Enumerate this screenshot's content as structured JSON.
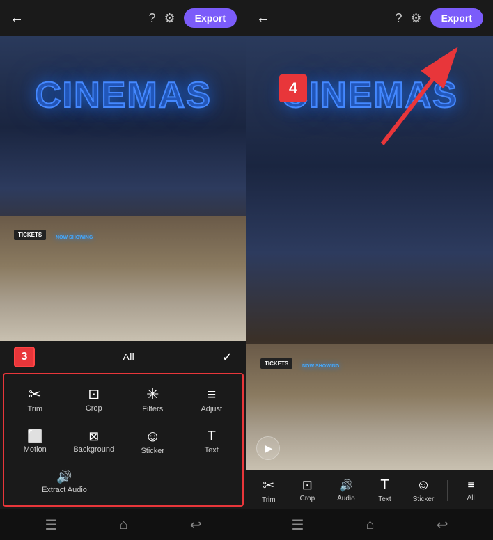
{
  "left": {
    "header": {
      "back_label": "←",
      "help_icon": "?",
      "settings_icon": "⚙",
      "export_label": "Export"
    },
    "cinema_text": "CINEMAS",
    "toolbar": {
      "all_label": "All",
      "step_number": "3",
      "tools": [
        {
          "id": "trim",
          "icon": "✂",
          "label": "Trim"
        },
        {
          "id": "crop",
          "icon": "⊡",
          "label": "Crop"
        },
        {
          "id": "filters",
          "icon": "✳",
          "label": "Filters"
        },
        {
          "id": "adjust",
          "icon": "≡",
          "label": "Adjust"
        },
        {
          "id": "motion",
          "icon": "⬜",
          "label": "Motion"
        },
        {
          "id": "background",
          "icon": "⊠",
          "label": "Background"
        },
        {
          "id": "sticker",
          "icon": "☺",
          "label": "Sticker"
        },
        {
          "id": "text",
          "icon": "T",
          "label": "Text"
        },
        {
          "id": "extract-audio",
          "icon": "🔊",
          "label": "Extract Audio"
        }
      ]
    },
    "bottom_nav": [
      "☰",
      "⌂",
      "↩"
    ]
  },
  "right": {
    "header": {
      "back_label": "←",
      "help_icon": "?",
      "settings_icon": "⚙",
      "export_label": "Export"
    },
    "cinema_text": "CINEMAS",
    "step_number": "4",
    "toolbar": {
      "tools": [
        {
          "id": "trim",
          "icon": "✂",
          "label": "Trim"
        },
        {
          "id": "crop",
          "icon": "⊡",
          "label": "Crop"
        },
        {
          "id": "audio",
          "icon": "🔊",
          "label": "Audio"
        },
        {
          "id": "text",
          "icon": "T",
          "label": "Text"
        },
        {
          "id": "sticker",
          "icon": "☺",
          "label": "Sticker"
        },
        {
          "id": "all",
          "icon": "≡",
          "label": "All"
        }
      ]
    },
    "bottom_nav": [
      "☰",
      "⌂",
      "↩"
    ]
  }
}
